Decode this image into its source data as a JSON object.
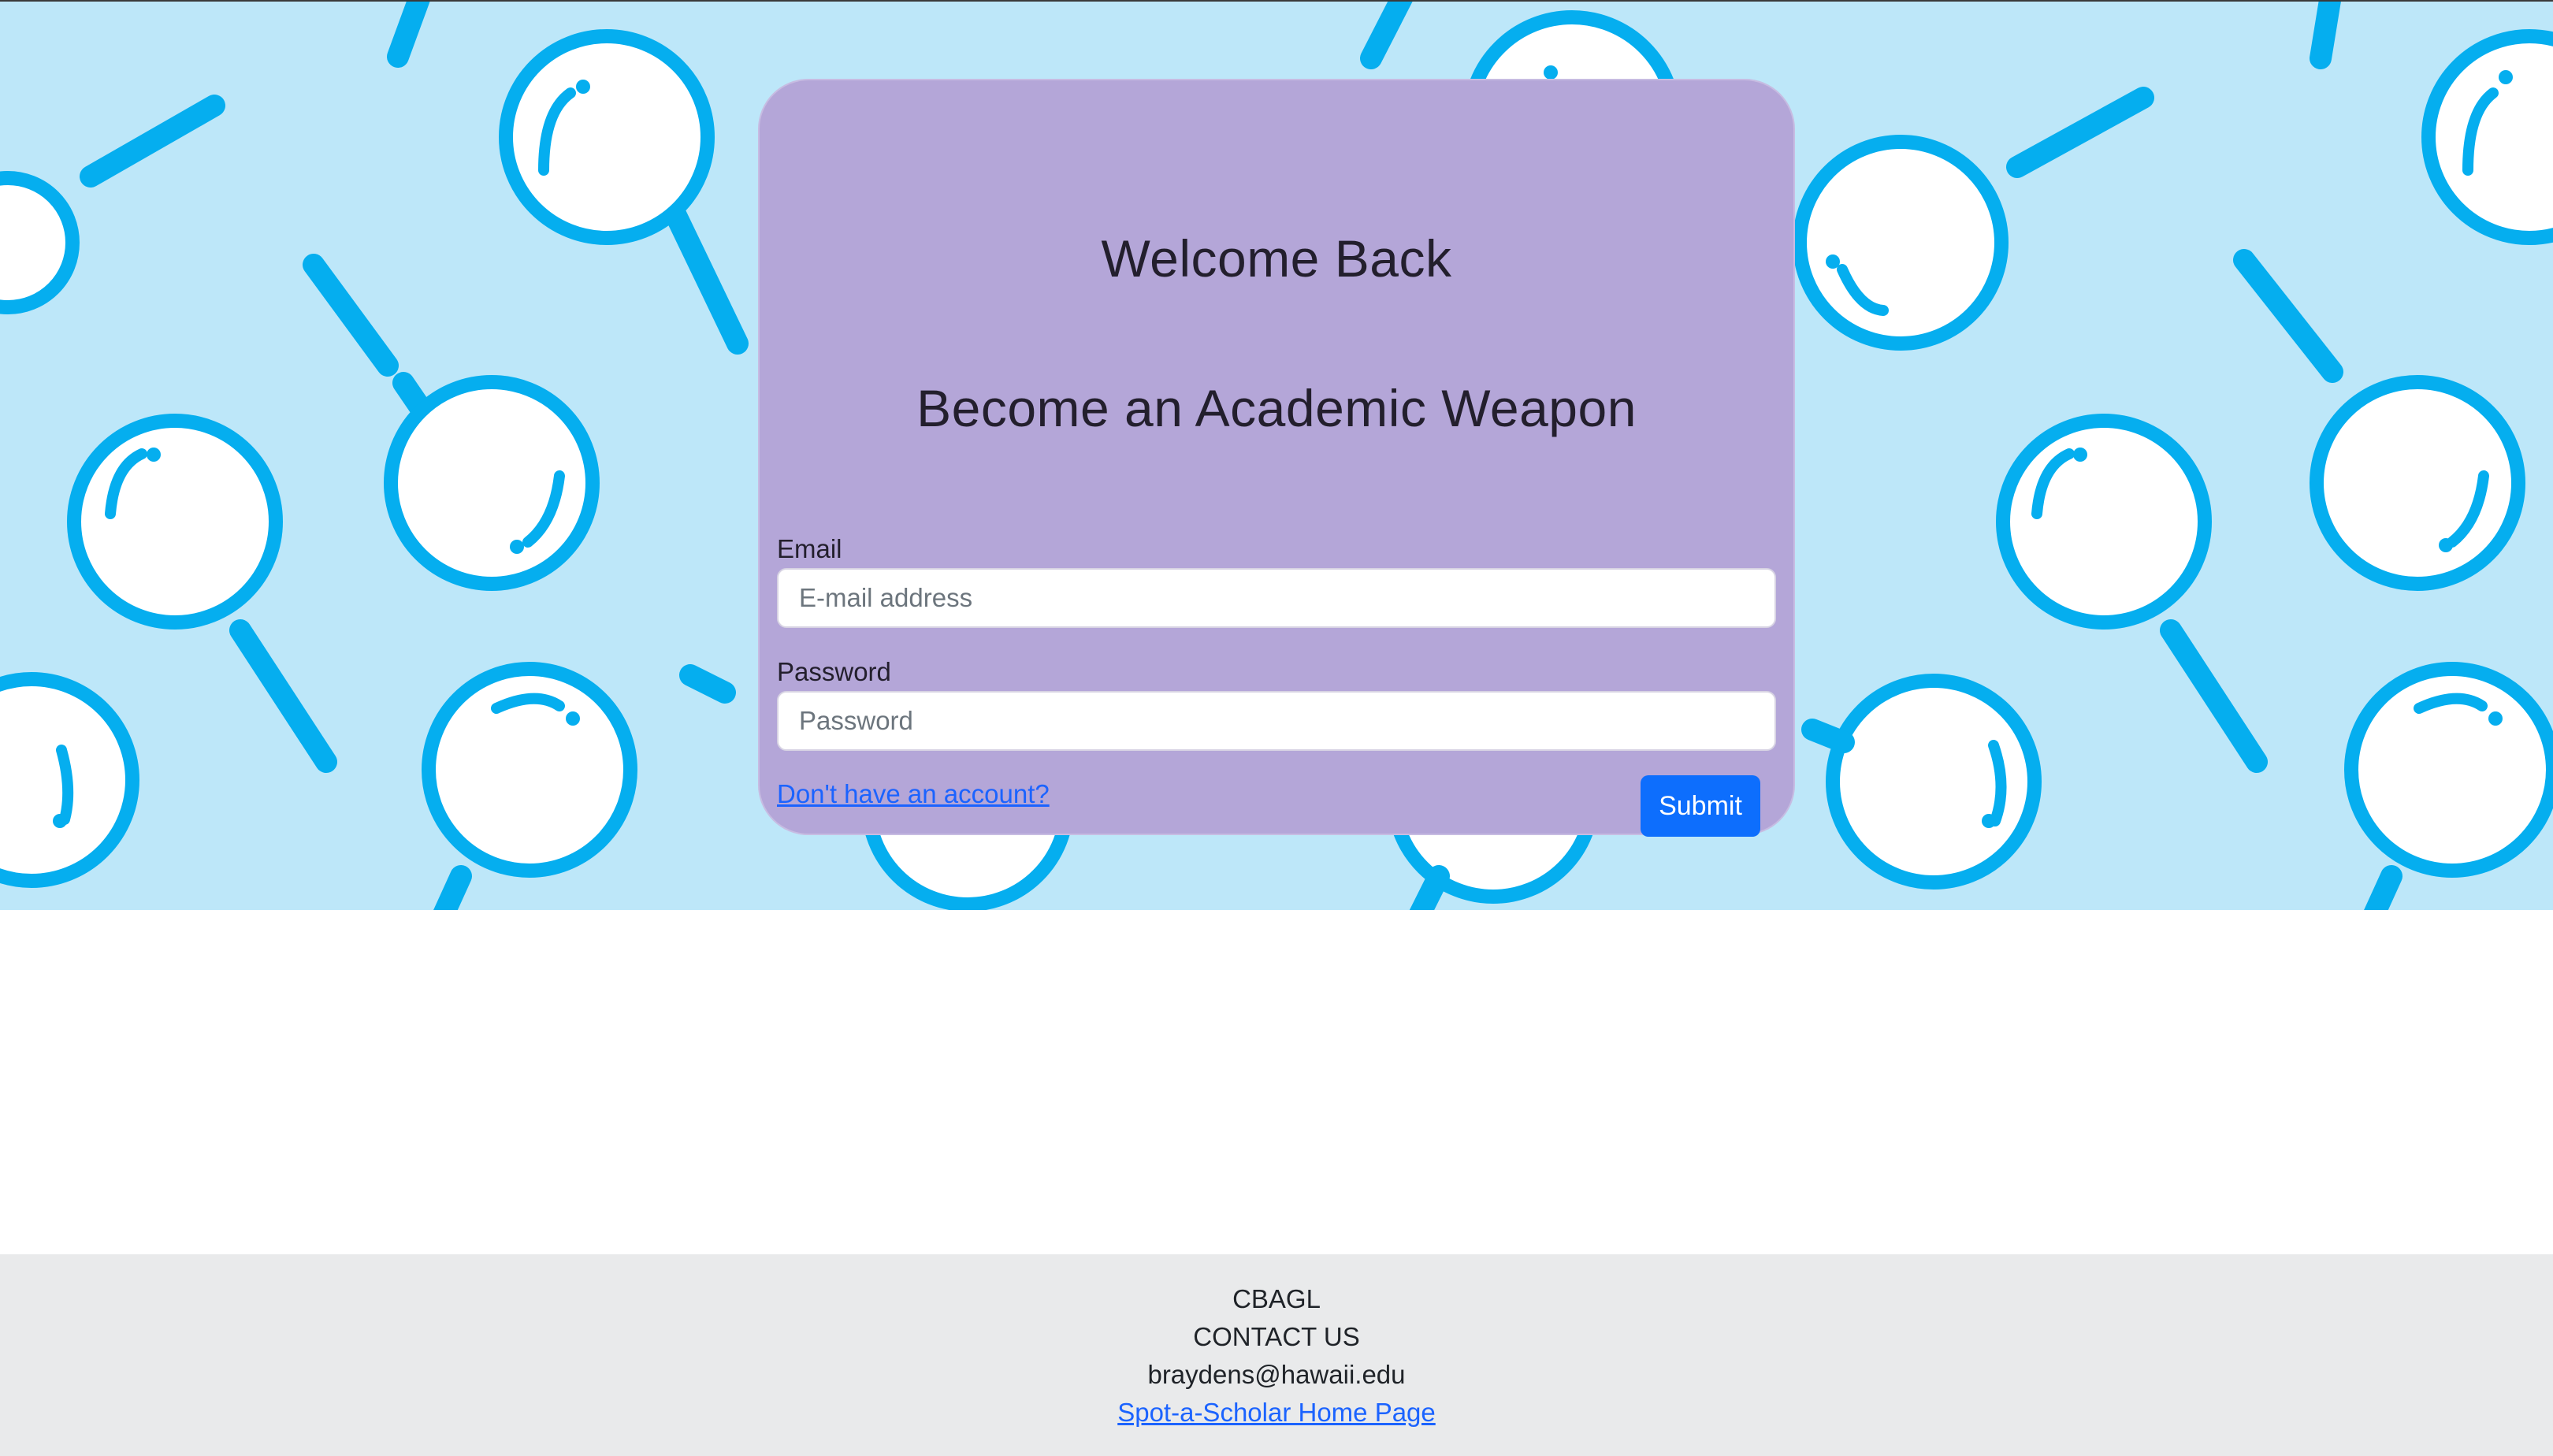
{
  "hero": {
    "background_color": "#bde7f9",
    "icon_color": "#05aeef",
    "pattern_icon": "magnifying-glass-icon"
  },
  "login": {
    "welcome_title": "Welcome Back",
    "tagline": "Become an Academic Weapon",
    "email_label": "Email",
    "email_placeholder": "E-mail address",
    "password_label": "Password",
    "password_placeholder": "Password",
    "signup_link": "Don't have an account?",
    "submit_label": "Submit",
    "card_color": "#b4a6d8",
    "submit_color": "#0d6efd"
  },
  "footer": {
    "brand": "CBAGL",
    "contact": "CONTACT US",
    "email": "braydens@hawaii.edu",
    "home_link": "Spot-a-Scholar Home Page"
  }
}
